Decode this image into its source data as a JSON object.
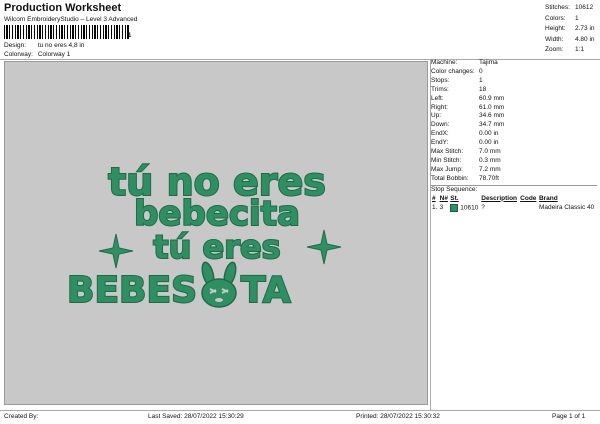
{
  "header": {
    "title": "Production Worksheet",
    "subtitle": "Wilcom EmbroideryStudio – Level 3 Advanced",
    "barcode_number": "1",
    "design_label": "Design:",
    "design_value": "tu no eres 4,8 in",
    "colorway_label": "Colorway:",
    "colorway_value": "Colorway 1"
  },
  "stats": [
    {
      "k": "Stitches:",
      "v": "10612"
    },
    {
      "k": "Colors:",
      "v": "1"
    },
    {
      "k": "Height:",
      "v": "2.73 in"
    },
    {
      "k": "Width:",
      "v": "4.80 in"
    },
    {
      "k": "Zoom:",
      "v": "1:1"
    }
  ],
  "machine_info": [
    {
      "k": "Machine:",
      "v": "Tajima"
    },
    {
      "k": "Color changes:",
      "v": "0"
    },
    {
      "k": "Stops:",
      "v": "1"
    },
    {
      "k": "Trims:",
      "v": "18"
    },
    {
      "k": "Left:",
      "v": "60.9 mm"
    },
    {
      "k": "Right:",
      "v": "61.0 mm"
    },
    {
      "k": "Up:",
      "v": "34.6 mm"
    },
    {
      "k": "Down:",
      "v": "34.7 mm"
    },
    {
      "k": "EndX:",
      "v": "0.00 in"
    },
    {
      "k": "EndY:",
      "v": "0.00 in"
    },
    {
      "k": "Max Stitch:",
      "v": "7.0 mm"
    },
    {
      "k": "Min Stitch:",
      "v": "0.3 mm"
    },
    {
      "k": "Max Jump:",
      "v": "7.2 mm"
    },
    {
      "k": "Total Bobbin:",
      "v": "78.70ft"
    }
  ],
  "stop_sequence": {
    "label": "Stop Sequence:",
    "headers": [
      "#",
      "N#",
      "St.",
      "Description",
      "Code",
      "Brand"
    ],
    "rows": [
      {
        "num": "1.",
        "n": "3",
        "st": "10610",
        "desc": "?",
        "code": "",
        "brand": "Madeira Classic 40"
      }
    ]
  },
  "design": {
    "line1": "tú no eres",
    "line2": "bebecita",
    "line3": "tú eres",
    "line4a": "BEBES",
    "line4b": "TA",
    "thread_color": "#2f8f62"
  },
  "footer": {
    "created": "Created By:",
    "saved": "Last Saved: 28/07/2022 15:30:29",
    "printed": "Printed: 28/07/2022 15:30:32",
    "page": "Page 1 of 1"
  }
}
